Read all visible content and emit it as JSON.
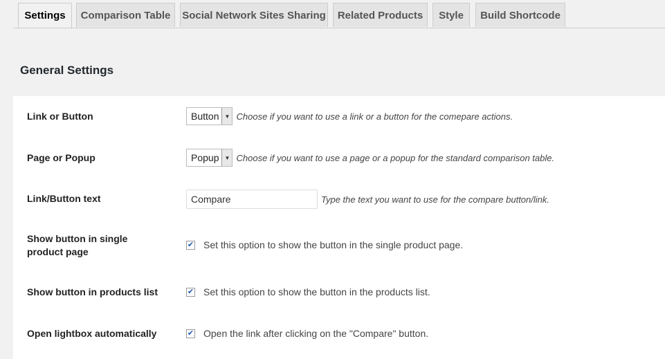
{
  "tabs": [
    {
      "label": "Settings",
      "active": true
    },
    {
      "label": "Comparison Table",
      "active": false
    },
    {
      "label": "Social Network Sites Sharing",
      "active": false
    },
    {
      "label": "Related Products",
      "active": false
    },
    {
      "label": "Style",
      "active": false
    },
    {
      "label": "Build Shortcode",
      "active": false
    }
  ],
  "section": {
    "title": "General Settings"
  },
  "settings": {
    "link_or_button": {
      "label": "Link or Button",
      "selected": "Button",
      "description": "Choose if you want to use a link or a button for the comepare actions."
    },
    "page_or_popup": {
      "label": "Page or Popup",
      "selected": "Popup",
      "description": "Choose if you want to use a page or a popup for the standard comparison table."
    },
    "button_text": {
      "label": "Link/Button text",
      "value": "Compare",
      "description": "Type the text you want to use for the compare button/link."
    },
    "show_single": {
      "label": "Show button in single product page",
      "checked": true,
      "description": "Set this option to show the button in the single product page."
    },
    "show_list": {
      "label": "Show button in products list",
      "checked": true,
      "description": "Set this option to show the button in the products list."
    },
    "open_lightbox": {
      "label": "Open lightbox automatically",
      "checked": true,
      "description": "Open the link after clicking on the \"Compare\" button."
    }
  },
  "icons": {
    "dropdown": "triangle-down-icon",
    "checkmark": "checkmark-icon"
  }
}
